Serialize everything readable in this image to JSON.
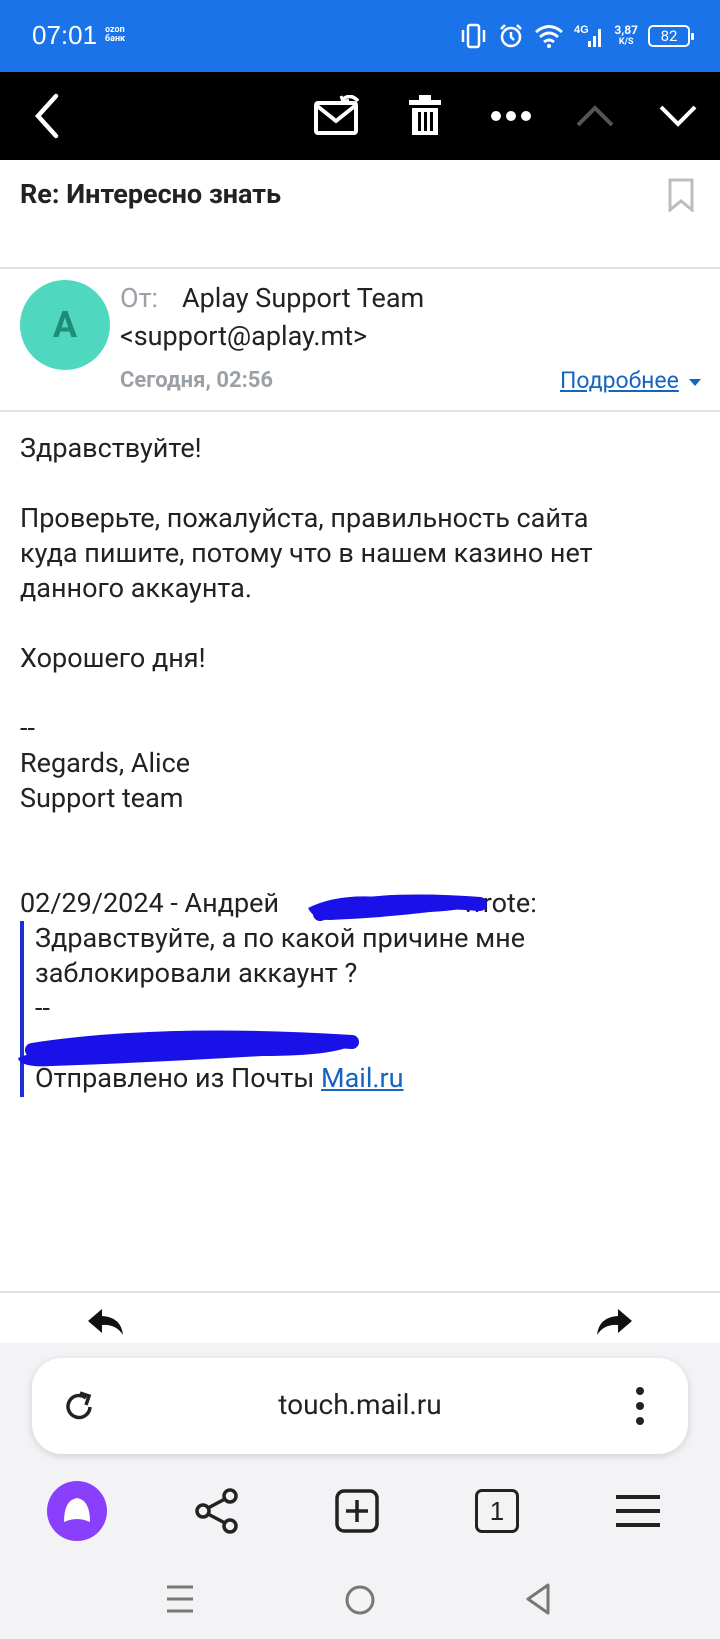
{
  "status": {
    "time": "07:01",
    "ozon": "ozon банк",
    "speed_value": "3,87",
    "speed_unit": "K/S",
    "network": "4G",
    "battery": "82"
  },
  "email": {
    "subject": "Re: Интересно знать",
    "avatar_letter": "A",
    "from_label": "От:",
    "from_name": "Aplay Support Team",
    "from_email": "<support@aplay.mt>",
    "date": "Сегодня, 02:56",
    "more_link": "Подробнее",
    "body": {
      "greeting": "Здравствуйте!",
      "para1_line1": "Проверьте, пожалуйста, правильность сайта",
      "para1_line2": "куда пишите, потому что в нашем казино нет",
      "para1_line3": "данного аккаунта.",
      "closing": "Хорошего дня!",
      "sig_dash": "--",
      "sig_regards": "Regards, Alice",
      "sig_team": "Support team",
      "quote_header_start": "02/29/2024 - Андрей",
      "quote_header_end": "wrote:",
      "quote_line1": "Здравствуйте, а по какой причине мне",
      "quote_line2": "заблокировали аккаунт ?",
      "quote_dash": "--",
      "quote_sent_from": "Отправлено из Почты",
      "quote_link": "Mail.ru"
    }
  },
  "browser": {
    "url": "touch.mail.ru",
    "tabs_count": "1"
  },
  "colors": {
    "status_bar": "#1a73e8",
    "toolbar": "#000000",
    "link": "#1565c0",
    "avatar_bg": "#4fd8bf",
    "quote_bar": "#1f2fd6",
    "alice_purple": "#8a3ffc"
  }
}
